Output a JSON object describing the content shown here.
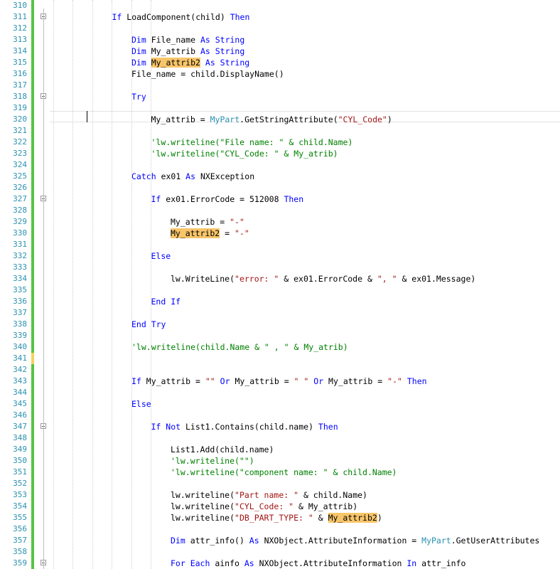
{
  "editor": {
    "colors": {
      "keyword": "#0000ff",
      "type": "#2b91af",
      "string": "#a31515",
      "comment": "#008000",
      "highlight": "#f8c56a",
      "change_saved": "#57c443",
      "change_unsaved": "#f3d35f"
    },
    "lines": [
      {
        "n": "310",
        "indent": 0,
        "tokens": []
      },
      {
        "n": "311",
        "indent": 2,
        "fold": true,
        "tokens": [
          {
            "t": "If ",
            "c": "kw"
          },
          {
            "t": "LoadComponent(child) "
          },
          {
            "t": "Then",
            "c": "kw"
          }
        ]
      },
      {
        "n": "312",
        "indent": 0,
        "tokens": []
      },
      {
        "n": "313",
        "indent": 3,
        "tokens": [
          {
            "t": "Dim ",
            "c": "kw"
          },
          {
            "t": "File_name "
          },
          {
            "t": "As String",
            "c": "kw"
          }
        ]
      },
      {
        "n": "314",
        "indent": 3,
        "tokens": [
          {
            "t": "Dim ",
            "c": "kw"
          },
          {
            "t": "My_attrib "
          },
          {
            "t": "As String",
            "c": "kw"
          }
        ]
      },
      {
        "n": "315",
        "indent": 3,
        "tokens": [
          {
            "t": "Dim ",
            "c": "kw"
          },
          {
            "t": "My_attrib2",
            "c": "hl"
          },
          {
            "t": " "
          },
          {
            "t": "As String",
            "c": "kw"
          }
        ]
      },
      {
        "n": "316",
        "indent": 3,
        "tokens": [
          {
            "t": "File_name = child.DisplayName()"
          }
        ]
      },
      {
        "n": "317",
        "indent": 0,
        "tokens": []
      },
      {
        "n": "318",
        "indent": 3,
        "fold": true,
        "tokens": [
          {
            "t": "Try",
            "c": "kw"
          }
        ]
      },
      {
        "n": "319",
        "indent": 0,
        "tokens": []
      },
      {
        "n": "320",
        "indent": 4,
        "tokens": [
          {
            "t": "My_attrib = "
          },
          {
            "t": "MyPart",
            "c": "ty"
          },
          {
            "t": ".GetStringAttribute("
          },
          {
            "t": "\"CYL_Code\"",
            "c": "str"
          },
          {
            "t": ")"
          }
        ]
      },
      {
        "n": "321",
        "indent": 0,
        "tokens": []
      },
      {
        "n": "322",
        "indent": 4,
        "tokens": [
          {
            "t": "'lw.writeline(\"File name: \" & child.Name)",
            "c": "cm"
          }
        ]
      },
      {
        "n": "323",
        "indent": 4,
        "tokens": [
          {
            "t": "'lw.writeline(\"CYL_Code: \" & My_atrib)",
            "c": "cm"
          }
        ]
      },
      {
        "n": "324",
        "indent": 0,
        "tokens": []
      },
      {
        "n": "325",
        "indent": 3,
        "tokens": [
          {
            "t": "Catch ",
            "c": "kw"
          },
          {
            "t": "ex01 "
          },
          {
            "t": "As ",
            "c": "kw"
          },
          {
            "t": "NXException"
          }
        ]
      },
      {
        "n": "326",
        "indent": 0,
        "tokens": []
      },
      {
        "n": "327",
        "indent": 4,
        "fold": true,
        "tokens": [
          {
            "t": "If ",
            "c": "kw"
          },
          {
            "t": "ex01.ErrorCode = 512008 "
          },
          {
            "t": "Then",
            "c": "kw"
          }
        ]
      },
      {
        "n": "328",
        "indent": 0,
        "tokens": []
      },
      {
        "n": "329",
        "indent": 5,
        "tokens": [
          {
            "t": "My_attrib = "
          },
          {
            "t": "\"-\"",
            "c": "str"
          }
        ]
      },
      {
        "n": "330",
        "indent": 5,
        "tokens": [
          {
            "t": "My_attrib2",
            "c": "hl"
          },
          {
            "t": " = "
          },
          {
            "t": "\"-\"",
            "c": "str"
          }
        ]
      },
      {
        "n": "331",
        "indent": 0,
        "tokens": []
      },
      {
        "n": "332",
        "indent": 4,
        "tokens": [
          {
            "t": "Else",
            "c": "kw"
          }
        ]
      },
      {
        "n": "333",
        "indent": 0,
        "tokens": []
      },
      {
        "n": "334",
        "indent": 5,
        "tokens": [
          {
            "t": "lw.WriteLine("
          },
          {
            "t": "\"error: \"",
            "c": "str"
          },
          {
            "t": " & ex01.ErrorCode & "
          },
          {
            "t": "\", \"",
            "c": "str"
          },
          {
            "t": " & ex01.Message)"
          }
        ]
      },
      {
        "n": "335",
        "indent": 0,
        "tokens": []
      },
      {
        "n": "336",
        "indent": 4,
        "tokens": [
          {
            "t": "End If",
            "c": "kw"
          }
        ]
      },
      {
        "n": "337",
        "indent": 0,
        "tokens": []
      },
      {
        "n": "338",
        "indent": 3,
        "tokens": [
          {
            "t": "End Try",
            "c": "kw"
          }
        ]
      },
      {
        "n": "339",
        "indent": 0,
        "tokens": []
      },
      {
        "n": "340",
        "indent": 3,
        "tokens": [
          {
            "t": "'lw.writeline(child.Name & \" , \" & My_atrib)",
            "c": "cm"
          }
        ]
      },
      {
        "n": "341",
        "indent": 0,
        "tokens": []
      },
      {
        "n": "342",
        "indent": 0,
        "tokens": []
      },
      {
        "n": "343",
        "indent": 3,
        "tokens": [
          {
            "t": "If ",
            "c": "kw"
          },
          {
            "t": "My_attrib = "
          },
          {
            "t": "\"\"",
            "c": "str"
          },
          {
            "t": " "
          },
          {
            "t": "Or ",
            "c": "kw"
          },
          {
            "t": "My_attrib = "
          },
          {
            "t": "\" \"",
            "c": "str"
          },
          {
            "t": " "
          },
          {
            "t": "Or ",
            "c": "kw"
          },
          {
            "t": "My_attrib = "
          },
          {
            "t": "\"-\"",
            "c": "str"
          },
          {
            "t": " "
          },
          {
            "t": "Then",
            "c": "kw"
          }
        ]
      },
      {
        "n": "344",
        "indent": 0,
        "tokens": []
      },
      {
        "n": "345",
        "indent": 3,
        "tokens": [
          {
            "t": "Else",
            "c": "kw"
          }
        ]
      },
      {
        "n": "346",
        "indent": 0,
        "tokens": []
      },
      {
        "n": "347",
        "indent": 4,
        "fold": true,
        "tokens": [
          {
            "t": "If ",
            "c": "kw"
          },
          {
            "t": "Not ",
            "c": "kw"
          },
          {
            "t": "List1.Contains(child.name) "
          },
          {
            "t": "Then",
            "c": "kw"
          }
        ]
      },
      {
        "n": "348",
        "indent": 0,
        "tokens": []
      },
      {
        "n": "349",
        "indent": 5,
        "tokens": [
          {
            "t": "List1.Add(child.name)"
          }
        ]
      },
      {
        "n": "350",
        "indent": 5,
        "tokens": [
          {
            "t": "'lw.writeline(\"\")",
            "c": "cm"
          }
        ]
      },
      {
        "n": "351",
        "indent": 5,
        "tokens": [
          {
            "t": "'lw.writeline(\"component name: \" & child.Name)",
            "c": "cm"
          }
        ]
      },
      {
        "n": "352",
        "indent": 0,
        "tokens": []
      },
      {
        "n": "353",
        "indent": 5,
        "tokens": [
          {
            "t": "lw.writeline("
          },
          {
            "t": "\"Part name: \"",
            "c": "str"
          },
          {
            "t": " & child.Name)"
          }
        ]
      },
      {
        "n": "354",
        "indent": 5,
        "tokens": [
          {
            "t": "lw.writeline("
          },
          {
            "t": "\"CYL_Code: \"",
            "c": "str"
          },
          {
            "t": " & My_attrib)"
          }
        ]
      },
      {
        "n": "355",
        "indent": 5,
        "tokens": [
          {
            "t": "lw.writeline("
          },
          {
            "t": "\"DB_PART_TYPE: \"",
            "c": "str"
          },
          {
            "t": " & "
          },
          {
            "t": "My_attrib2",
            "c": "hl"
          },
          {
            "t": ")"
          }
        ]
      },
      {
        "n": "356",
        "indent": 0,
        "tokens": []
      },
      {
        "n": "357",
        "indent": 5,
        "tokens": [
          {
            "t": "Dim ",
            "c": "kw"
          },
          {
            "t": "attr_info() "
          },
          {
            "t": "As ",
            "c": "kw"
          },
          {
            "t": "NXObject.AttributeInformation = "
          },
          {
            "t": "MyPart",
            "c": "ty"
          },
          {
            "t": ".GetUserAttributes"
          }
        ]
      },
      {
        "n": "358",
        "indent": 0,
        "tokens": []
      },
      {
        "n": "359",
        "indent": 5,
        "fold": true,
        "tokens": [
          {
            "t": "For Each ",
            "c": "kw"
          },
          {
            "t": "ainfo "
          },
          {
            "t": "As ",
            "c": "kw"
          },
          {
            "t": "NXObject.AttributeInformation "
          },
          {
            "t": "In ",
            "c": "kw"
          },
          {
            "t": "attr_info"
          }
        ]
      }
    ]
  }
}
